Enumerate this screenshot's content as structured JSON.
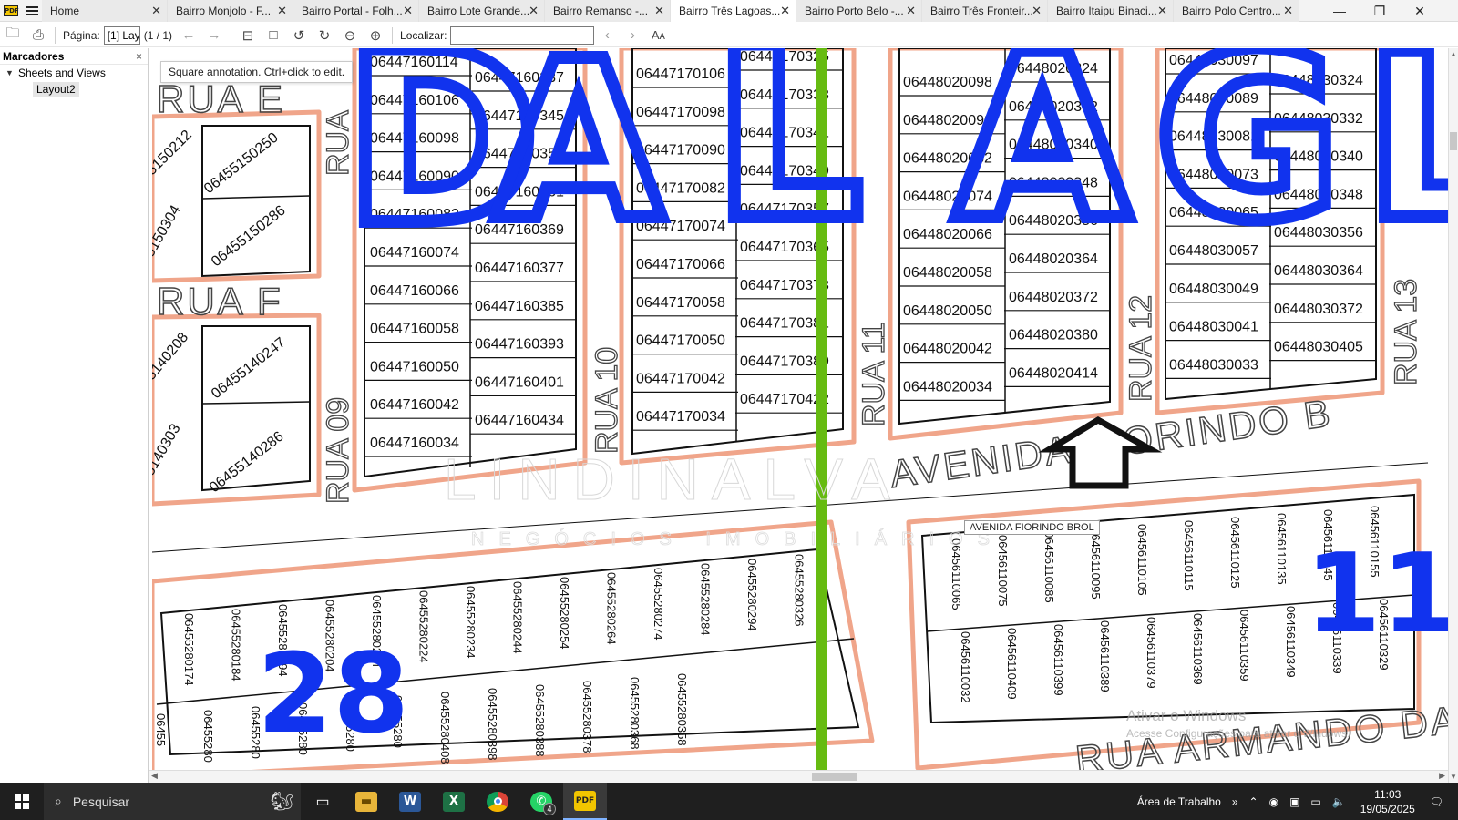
{
  "tabs": [
    {
      "label": "Home",
      "active": false
    },
    {
      "label": "Bairro Monjolo - F...",
      "active": false
    },
    {
      "label": "Bairro Portal - Folh...",
      "active": false
    },
    {
      "label": "Bairro Lote Grande...",
      "active": false
    },
    {
      "label": "Bairro Remanso -...",
      "active": false
    },
    {
      "label": "Bairro Três Lagoas...",
      "active": true
    },
    {
      "label": "Bairro Porto Belo -...",
      "active": false
    },
    {
      "label": "Bairro Três Fronteir...",
      "active": false
    },
    {
      "label": "Bairro Itaipu Binaci...",
      "active": false
    },
    {
      "label": "Bairro Polo Centro...",
      "active": false
    }
  ],
  "toolbar": {
    "page_label": "Página:",
    "page_value": "[1] Lay",
    "page_count": "(1 / 1)",
    "find_label": "Localizar:",
    "find_value": ""
  },
  "sidebar": {
    "title": "Marcadores",
    "close": "×",
    "tree_root": "Sheets and Views",
    "tree_child": "Layout2"
  },
  "tooltip": "Square annotation. Ctrl+click to edit.",
  "map": {
    "street_tag": "AVENIDA FIORINDO BROL",
    "streets": {
      "rua_e": "RUA E",
      "rua_f": "RUA F",
      "rua": "RUA",
      "rua_09": "RUA 09",
      "rua_10": "RUA 10",
      "rua_11": "RUA 11",
      "rua_12": "RUA 12",
      "rua_13": "RUA 13",
      "avenida": "AVENIDA FIORINDO B",
      "armando": "RUA ARMANDO DAL"
    },
    "watermark_brand": "LINDINALVA",
    "watermark_sub": "NEGÓCIOS IMOBILIÁRIOS",
    "big_letters": [
      "D",
      "A",
      "L",
      "A",
      "G",
      "L"
    ],
    "block_numbers": [
      "28",
      "11"
    ],
    "colors": {
      "block_outline": "#f0a58a",
      "label_blue": "#1133ee",
      "green_line": "#66bb11"
    },
    "block_5150": [
      "5150212",
      "06455150250",
      "5150304",
      "06455150286"
    ],
    "block_5140": [
      "5140208",
      "06455140247",
      "5140303",
      "06455140286"
    ],
    "block_716_left": [
      "06447160114",
      "06447160106",
      "06447160098",
      "06447160090",
      "06447160082",
      "06447160074",
      "06447160066",
      "06447160058",
      "06447160050",
      "06447160042",
      "06447160034"
    ],
    "block_716_right": [
      "06447160337",
      "06447160345",
      "06447160353",
      "06447160361",
      "06447160369",
      "06447160377",
      "06447160385",
      "06447160393",
      "06447160401",
      "06447160434"
    ],
    "block_717_left": [
      "06447170106",
      "06447170098",
      "06447170090",
      "06447170082",
      "06447170074",
      "06447170066",
      "06447170058",
      "06447170050",
      "06447170042",
      "06447170034"
    ],
    "block_717_right": [
      "06447170325",
      "06447170333",
      "06447170341",
      "06447170349",
      "06447170357",
      "06447170365",
      "06447170373",
      "06447170381",
      "06447170389",
      "06447170422"
    ],
    "block_802_left": [
      "06448020098",
      "06448020090",
      "06448020082",
      "06448020074",
      "06448020066",
      "06448020058",
      "06448020050",
      "06448020042",
      "06448020034"
    ],
    "block_802_right": [
      "06448020324",
      "06448020332",
      "06448020340",
      "06448020348",
      "06448020356",
      "06448020364",
      "06448020372",
      "06448020380",
      "06448020414"
    ],
    "block_803_left": [
      "06448030097",
      "06448030089",
      "06448030081",
      "06448030073",
      "06448030065",
      "06448030057",
      "06448030049",
      "06448030041",
      "06448030033"
    ],
    "block_803_right": [
      "06448030324",
      "06448030332",
      "06448030340",
      "06448030348",
      "06448030356",
      "06448030364",
      "06448030372",
      "06448030405"
    ],
    "block_5528_top": [
      "06455280174",
      "06455280184",
      "06455280194",
      "06455280204",
      "06455280214",
      "06455280224",
      "06455280234",
      "06455280244",
      "06455280254",
      "06455280264",
      "06455280274",
      "06455280284",
      "06455280294",
      "06455280326"
    ],
    "block_5528_bottom": [
      "06455",
      "06455280",
      "06455280",
      "06455280",
      "06455280",
      "06455280",
      "06455280408",
      "06455280398",
      "06455280388",
      "06455280378",
      "06455280368",
      "06455280358"
    ],
    "block_5611_top": [
      "06456110065",
      "06456110075",
      "06456110085",
      "06456110095",
      "06456110105",
      "06456110115",
      "06456110125",
      "06456110135",
      "06456110145",
      "06456110155"
    ],
    "block_5611_bottom": [
      "06456110032",
      "06456110409",
      "06456110399",
      "06456110389",
      "06456110379",
      "06456110369",
      "06456110359",
      "06456110349",
      "06456110339",
      "06456110329"
    ]
  },
  "windows_watermark": {
    "line1": "Ativar o Windows",
    "line2": "Acesse Configurações para ativar o Windows."
  },
  "taskbar": {
    "search_placeholder": "Pesquisar",
    "desktop_label": "Área de Trabalho",
    "time": "11:03",
    "date": "19/05/2025",
    "whatsapp_badge": "4",
    "apps": [
      "task-view",
      "file-explorer",
      "word",
      "excel",
      "chrome",
      "whatsapp",
      "pdf-xchange"
    ]
  }
}
